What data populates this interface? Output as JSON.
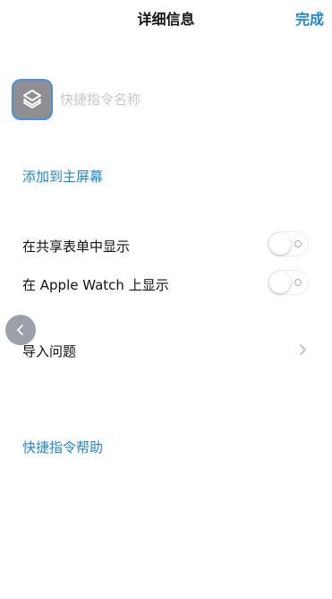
{
  "navbar": {
    "title": "详细信息",
    "done_label": "完成"
  },
  "shortcut": {
    "icon": "layers-icon",
    "name_value": "",
    "name_placeholder": "快捷指令名称"
  },
  "add_to_home_label": "添加到主屏幕",
  "toggles": [
    {
      "label": "在共享表单中显示",
      "on": false
    },
    {
      "label": "在 Apple Watch 上显示",
      "on": false
    }
  ],
  "import_questions_label": "导入问题",
  "help_label": "快捷指令帮助",
  "colors": {
    "accent": "#1f86d6",
    "icon_background": "#8e8e93",
    "placeholder": "#c8c8cc"
  }
}
